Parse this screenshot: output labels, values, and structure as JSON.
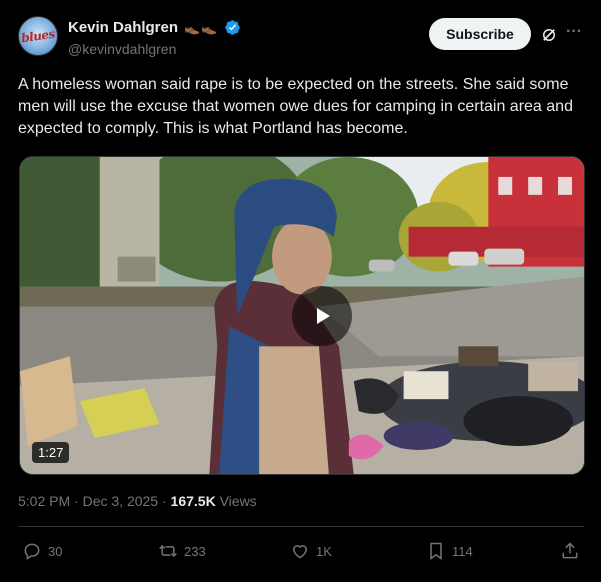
{
  "author": {
    "avatar_text": "blues",
    "display_name": "Kevin Dahlgren",
    "emoji": "👞👞",
    "handle": "@kevinvdahlgren",
    "verified_icon": "verified-badge-icon"
  },
  "header": {
    "subscribe_label": "Subscribe",
    "more_label": "···"
  },
  "post": {
    "text": "A homeless woman said rape is to be expected on the streets. She said some men will use the excuse that women owe dues for camping in certain area and expected to comply. This is what Portland has become."
  },
  "media": {
    "type": "video",
    "duration": "1:27"
  },
  "meta": {
    "time": "5:02 PM",
    "separator": " · ",
    "date": "Dec 3, 2025",
    "views_count": "167.5K",
    "views_label": " Views"
  },
  "actions": {
    "replies": "30",
    "reposts": "233",
    "likes": "1K",
    "bookmarks": "114"
  },
  "colors": {
    "background": "#000000",
    "text_primary": "#e7e9ea",
    "text_secondary": "#71767b",
    "verified": "#1d9bf0",
    "divider": "#2f3336"
  }
}
